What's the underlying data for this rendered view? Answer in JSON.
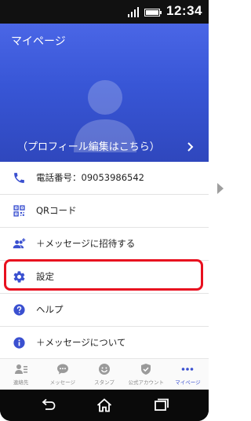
{
  "status_bar": {
    "time": "12:34"
  },
  "header": {
    "title": "マイページ",
    "profile_edit_label": "（プロフィール編集はこちら）"
  },
  "menu": {
    "items": [
      {
        "label": "電話番号：09053986542",
        "icon": "phone-icon"
      },
      {
        "label": "QRコード",
        "icon": "qr-code-icon"
      },
      {
        "label": "＋メッセージに招待する",
        "icon": "invite-users-icon"
      },
      {
        "label": "設定",
        "icon": "gear-icon"
      },
      {
        "label": "ヘルプ",
        "icon": "help-icon"
      },
      {
        "label": "＋メッセージについて",
        "icon": "info-icon"
      }
    ]
  },
  "bottom_nav": {
    "tabs": [
      {
        "label": "連絡先",
        "icon": "contacts-icon",
        "active": false
      },
      {
        "label": "メッセージ",
        "icon": "chat-bubble-icon",
        "active": false
      },
      {
        "label": "スタンプ",
        "icon": "smiley-icon",
        "active": false
      },
      {
        "label": "公式アカウント",
        "icon": "shield-check-icon",
        "active": false
      },
      {
        "label": "マイページ",
        "icon": "more-dots-icon",
        "active": true
      }
    ]
  },
  "colors": {
    "header_blue": "#3856d6",
    "icon_blue": "#3a50d0",
    "highlight_red": "#e8101f"
  }
}
